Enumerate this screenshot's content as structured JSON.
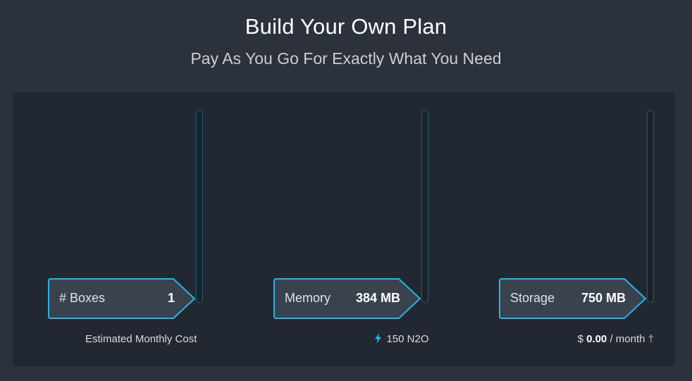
{
  "header": {
    "title": "Build Your Own Plan",
    "subtitle": "Pay As You Go For Exactly What You Need"
  },
  "sliders": [
    {
      "label": "# Boxes",
      "value": "1"
    },
    {
      "label": "Memory",
      "value": "384 MB"
    },
    {
      "label": "Storage",
      "value": "750 MB"
    }
  ],
  "footer": {
    "estimate_label": "Estimated Monthly Cost",
    "n2o_value": "150 N2O",
    "currency": "$",
    "cost": "0.00",
    "per": "/ month",
    "dagger": "†"
  },
  "colors": {
    "accent": "#2ab4ea",
    "background": "#2b323b",
    "panel": "#222831"
  },
  "icons": {
    "bolt": "lightning-bolt-icon"
  }
}
